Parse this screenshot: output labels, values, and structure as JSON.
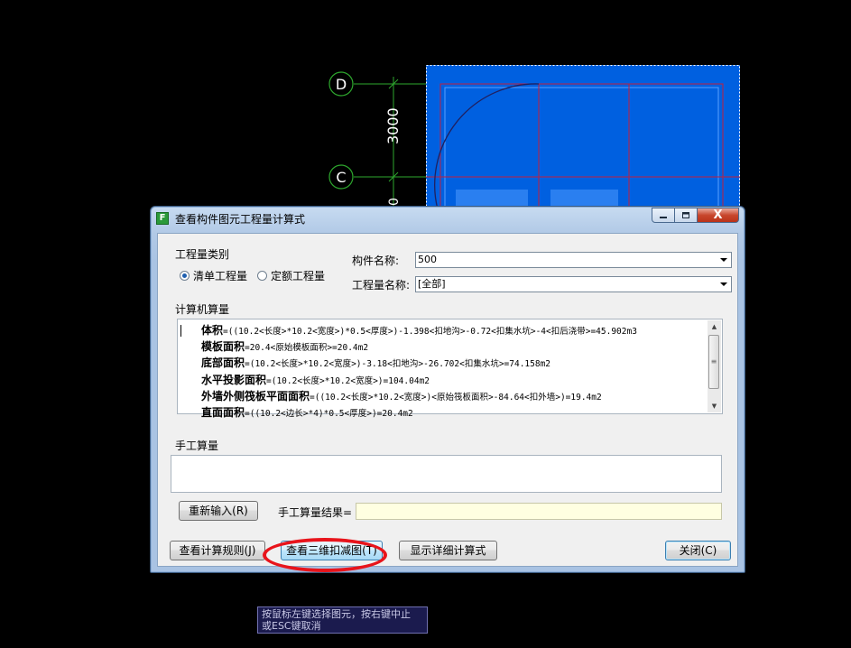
{
  "cad": {
    "axis_d": "D",
    "axis_c": "C",
    "dimension": "3000",
    "dimension_partial": "0"
  },
  "dialog": {
    "title": "查看构件图元工程量计算式",
    "close_glyph": "X"
  },
  "quantity_type": {
    "label": "工程量类别",
    "options": [
      "清单工程量",
      "定额工程量"
    ],
    "selected": "清单工程量"
  },
  "component_name": {
    "label": "构件名称:",
    "value": "500"
  },
  "quantity_name": {
    "label": "工程量名称:",
    "value": "[全部]"
  },
  "computer_calc": {
    "label": "计算机算量",
    "lines": [
      {
        "name": "体积",
        "expr": "=((10.2<长度>*10.2<宽度>)*0.5<厚度>)-1.398<扣地沟>-0.72<扣集水坑>-4<扣后浇带>=45.902m3"
      },
      {
        "name": "模板面积",
        "expr": "=20.4<原始模板面积>=20.4m2"
      },
      {
        "name": "底部面积",
        "expr": "=(10.2<长度>*10.2<宽度>)-3.18<扣地沟>-26.702<扣集水坑>=74.158m2"
      },
      {
        "name": "水平投影面积",
        "expr": "=(10.2<长度>*10.2<宽度>)=104.04m2"
      },
      {
        "name": "外墙外侧筏板平面面积",
        "expr": "=((10.2<长度>*10.2<宽度>)<原始筏板面积>-84.64<扣外墙>)=19.4m2"
      },
      {
        "name": "直面面积",
        "expr": "=((10.2<边长>*4)*0.5<厚度>)=20.4m2"
      }
    ],
    "scroll_thumb_glyph": "≡"
  },
  "manual_calc": {
    "label": "手工算量",
    "value": "",
    "reenter_button": "重新输入(R)",
    "result_label": "手工算量结果=",
    "result_value": ""
  },
  "footer": {
    "view_rules_button": "查看计算规则(J)",
    "view_3d_button": "查看三维扣减图(T)",
    "show_detail_button": "显示详细计算式",
    "close_button": "关闭(C)"
  },
  "status_tip": {
    "line1": "按鼠标左键选择图元，按右键中止",
    "line2": "或ESC键取消"
  },
  "colors": {
    "cad_selection": "#0060e0",
    "axis_green": "#2ea82e",
    "highlight_ring": "#e8141b"
  }
}
